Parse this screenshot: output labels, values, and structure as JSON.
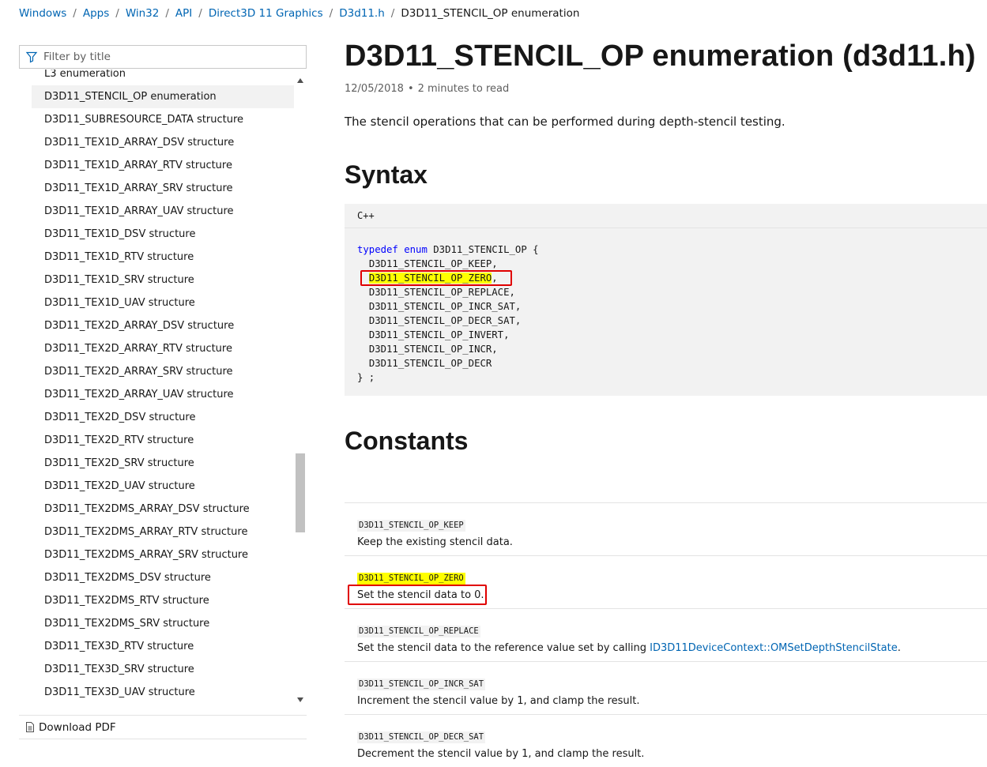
{
  "breadcrumb": {
    "items": [
      "Windows",
      "Apps",
      "Win32",
      "API",
      "Direct3D 11 Graphics",
      "D3d11.h"
    ],
    "current": "D3D11_STENCIL_OP enumeration"
  },
  "filter": {
    "placeholder": "Filter by title"
  },
  "toc": {
    "items": [
      "L3 enumeration",
      "D3D11_STENCIL_OP enumeration",
      "D3D11_SUBRESOURCE_DATA structure",
      "D3D11_TEX1D_ARRAY_DSV structure",
      "D3D11_TEX1D_ARRAY_RTV structure",
      "D3D11_TEX1D_ARRAY_SRV structure",
      "D3D11_TEX1D_ARRAY_UAV structure",
      "D3D11_TEX1D_DSV structure",
      "D3D11_TEX1D_RTV structure",
      "D3D11_TEX1D_SRV structure",
      "D3D11_TEX1D_UAV structure",
      "D3D11_TEX2D_ARRAY_DSV structure",
      "D3D11_TEX2D_ARRAY_RTV structure",
      "D3D11_TEX2D_ARRAY_SRV structure",
      "D3D11_TEX2D_ARRAY_UAV structure",
      "D3D11_TEX2D_DSV structure",
      "D3D11_TEX2D_RTV structure",
      "D3D11_TEX2D_SRV structure",
      "D3D11_TEX2D_UAV structure",
      "D3D11_TEX2DMS_ARRAY_DSV structure",
      "D3D11_TEX2DMS_ARRAY_RTV structure",
      "D3D11_TEX2DMS_ARRAY_SRV structure",
      "D3D11_TEX2DMS_DSV structure",
      "D3D11_TEX2DMS_RTV structure",
      "D3D11_TEX2DMS_SRV structure",
      "D3D11_TEX3D_RTV structure",
      "D3D11_TEX3D_SRV structure",
      "D3D11_TEX3D_UAV structure"
    ],
    "active_index": 1
  },
  "download": {
    "label": "Download PDF"
  },
  "article": {
    "title": "D3D11_STENCIL_OP enumeration (d3d11.h)",
    "date": "12/05/2018",
    "dot": "•",
    "read_time": "2 minutes to read",
    "summary": "The stencil operations that can be performed during depth-stencil testing.",
    "syntax_heading": "Syntax",
    "constants_heading": "Constants"
  },
  "code": {
    "language": "C++",
    "kw_typedef": "typedef",
    "kw_enum": "enum",
    "type_name": "D3D11_STENCIL_OP {",
    "members": [
      "D3D11_STENCIL_OP_KEEP,",
      "D3D11_STENCIL_OP_ZERO",
      "D3D11_STENCIL_OP_REPLACE,",
      "D3D11_STENCIL_OP_INCR_SAT,",
      "D3D11_STENCIL_OP_DECR_SAT,",
      "D3D11_STENCIL_OP_INVERT,",
      "D3D11_STENCIL_OP_INCR,",
      "D3D11_STENCIL_OP_DECR"
    ],
    "comma": ",",
    "closing": "} ;"
  },
  "constants": [
    {
      "name": "D3D11_STENCIL_OP_KEEP",
      "desc": "Keep the existing stencil data."
    },
    {
      "name": "D3D11_STENCIL_OP_ZERO",
      "desc": "Set the stencil data to 0."
    },
    {
      "name": "D3D11_STENCIL_OP_REPLACE",
      "desc": "Set the stencil data to the reference value set by calling ",
      "link": "ID3D11DeviceContext::OMSetDepthStencilState",
      "desc_end": "."
    },
    {
      "name": "D3D11_STENCIL_OP_INCR_SAT",
      "desc": "Increment the stencil value by 1, and clamp the result."
    },
    {
      "name": "D3D11_STENCIL_OP_DECR_SAT",
      "desc": "Decrement the stencil value by 1, and clamp the result."
    }
  ],
  "colors": {
    "link": "#0065b3",
    "highlight": "#ffff00",
    "annotation": "#e00000",
    "keyword": "#0101fd"
  }
}
